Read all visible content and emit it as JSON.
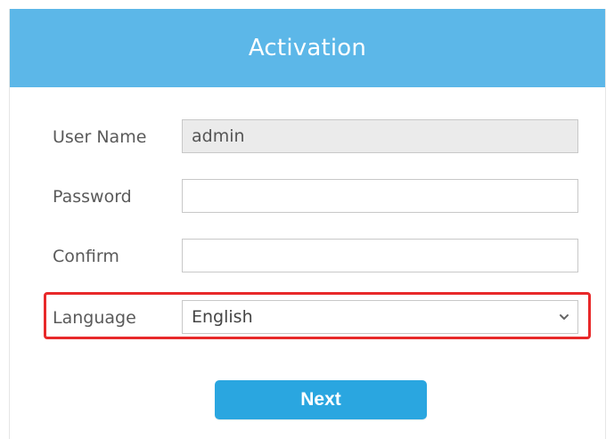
{
  "header": {
    "title": "Activation"
  },
  "form": {
    "username": {
      "label": "User Name",
      "value": "admin"
    },
    "password": {
      "label": "Password",
      "value": ""
    },
    "confirm": {
      "label": "Confirm",
      "value": ""
    },
    "language": {
      "label": "Language",
      "selected": "English",
      "icon": "chevron-down-icon"
    }
  },
  "actions": {
    "next_label": "Next"
  },
  "colors": {
    "header_bg": "#5cb7e8",
    "button_bg": "#2aa6e0",
    "highlight_border": "#e8292a",
    "readonly_bg": "#ebebeb"
  }
}
